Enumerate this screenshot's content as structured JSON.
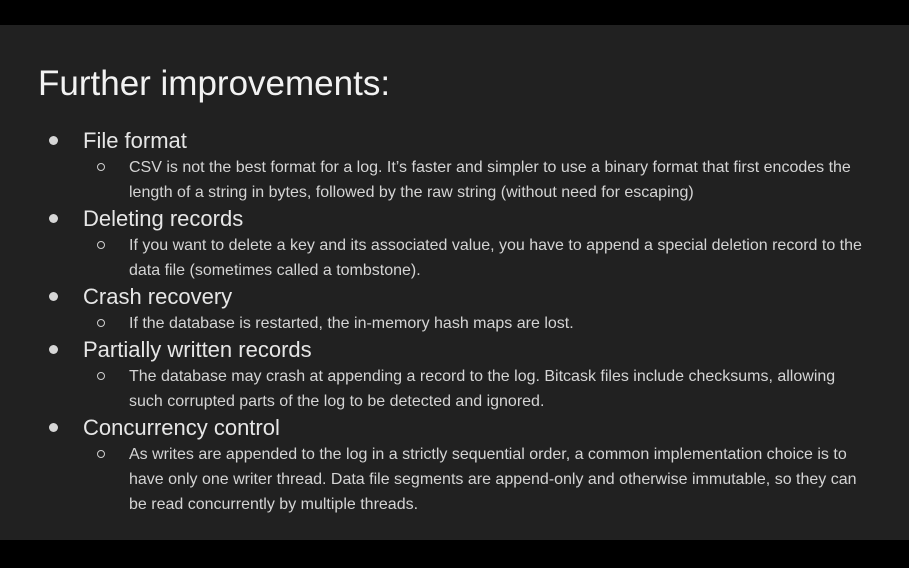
{
  "slide": {
    "title": "Further improvements:",
    "bullets": [
      {
        "heading": "File format",
        "sub": [
          "CSV is not the best format for a log. It’s faster and simpler to use a binary format that first encodes the length of a string in bytes, followed by the raw string (without need for escaping)"
        ]
      },
      {
        "heading": "Deleting records",
        "sub": [
          "If you want to delete a key and its associated value, you have to append a special deletion record to the data file (sometimes called a tombstone)."
        ]
      },
      {
        "heading": "Crash recovery",
        "sub": [
          "If the database is restarted, the in-memory hash maps are lost."
        ]
      },
      {
        "heading": "Partially written records",
        "sub": [
          "The database may crash at appending a record to the log. Bitcask files include checksums, allowing such corrupted parts of the log to be detected and ignored."
        ]
      },
      {
        "heading": "Concurrency control",
        "sub": [
          "As writes are appended to the log in a strictly sequential order, a common implementation choice is to have only one writer thread. Data file segments are append-only and otherwise immutable, so they can be read concurrently by multiple threads."
        ]
      }
    ]
  },
  "colors": {
    "background": "#212121",
    "letterbox": "#000000",
    "title": "#f2f2f2",
    "text": "#d4d4d4"
  }
}
